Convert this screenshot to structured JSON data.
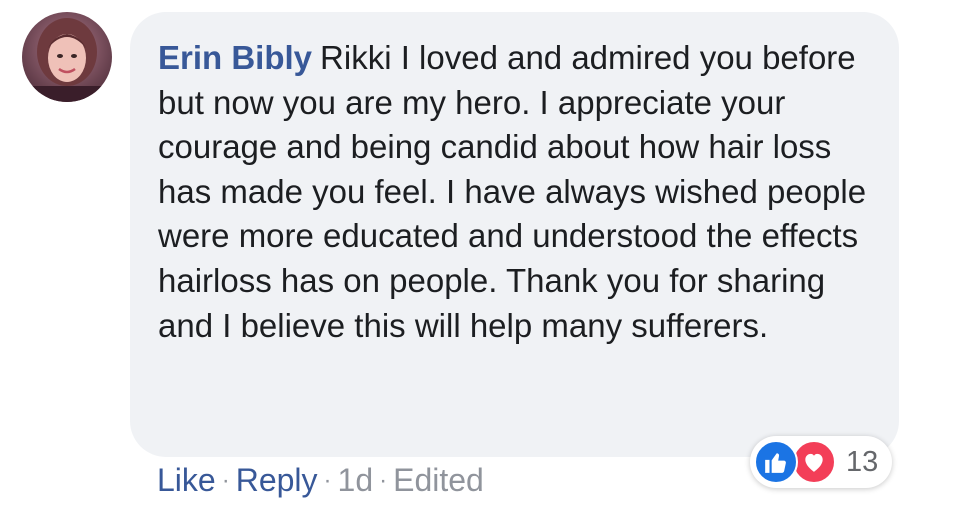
{
  "comment": {
    "author": "Erin Bibly",
    "text": "Rikki I loved and admired you before but now you are my hero. I appreciate your courage and being candid about how hair loss has made you feel. I have always wished people were more educated and understood the effects hairloss has on people. Thank you for sharing and I believe this will help many sufferers."
  },
  "actions": {
    "like_label": "Like",
    "reply_label": "Reply",
    "separator": "·",
    "timestamp": "1d",
    "edited_label": "Edited"
  },
  "reactions": {
    "icons": [
      "like-icon",
      "love-icon"
    ],
    "count": "13",
    "colors": {
      "like": "#1b74e4",
      "love": "#f33e58"
    }
  },
  "colors": {
    "bubble": "#f0f2f5",
    "author": "#385898",
    "text": "#1c1e21",
    "muted": "#90949c"
  }
}
